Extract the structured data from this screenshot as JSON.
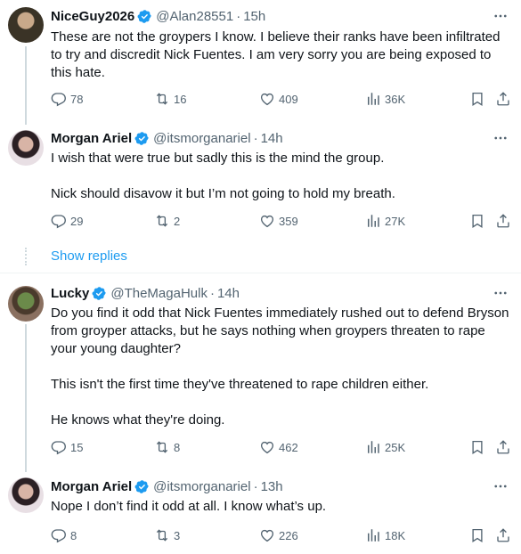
{
  "tweets": [
    {
      "name": "NiceGuy2026",
      "handle": "@Alan28551",
      "time": "15h",
      "text": "These are not the groypers I know. I believe their ranks have been infiltrated to try and discredit Nick Fuentes. I am very sorry you are being exposed to this hate.",
      "replies": "78",
      "retweets": "16",
      "likes": "409",
      "views": "36K"
    },
    {
      "name": "Morgan Ariel",
      "handle": "@itsmorganariel",
      "time": "14h",
      "text": "I wish that were true but sadly this is the mind the group.\n\nNick should disavow it but I’m not going to hold my breath.",
      "replies": "29",
      "retweets": "2",
      "likes": "359",
      "views": "27K"
    },
    {
      "name": "Lucky",
      "handle": "@TheMagaHulk",
      "time": "14h",
      "text": "Do you find it odd that Nick Fuentes immediately rushed out to defend Bryson from groyper attacks, but he says nothing when groypers threaten to rape your young daughter?\n\nThis isn't the first time they've threatened to rape children either.\n\nHe knows what they're doing.",
      "replies": "15",
      "retweets": "8",
      "likes": "462",
      "views": "25K"
    },
    {
      "name": "Morgan Ariel",
      "handle": "@itsmorganariel",
      "time": "13h",
      "text": "Nope I don’t find it odd at all. I know what’s up.",
      "replies": "8",
      "retweets": "3",
      "likes": "226",
      "views": "18K"
    }
  ],
  "show_replies": "Show replies",
  "dot": "·",
  "icons": {
    "verified": "verified-badge-icon",
    "more": "more-icon",
    "reply": "reply-icon",
    "retweet": "retweet-icon",
    "like": "heart-icon",
    "views": "views-icon",
    "bookmark": "bookmark-icon",
    "share": "share-icon"
  },
  "colors": {
    "accent": "#1d9bf0",
    "secondary_text": "#536471",
    "divider": "#eff3f4"
  }
}
